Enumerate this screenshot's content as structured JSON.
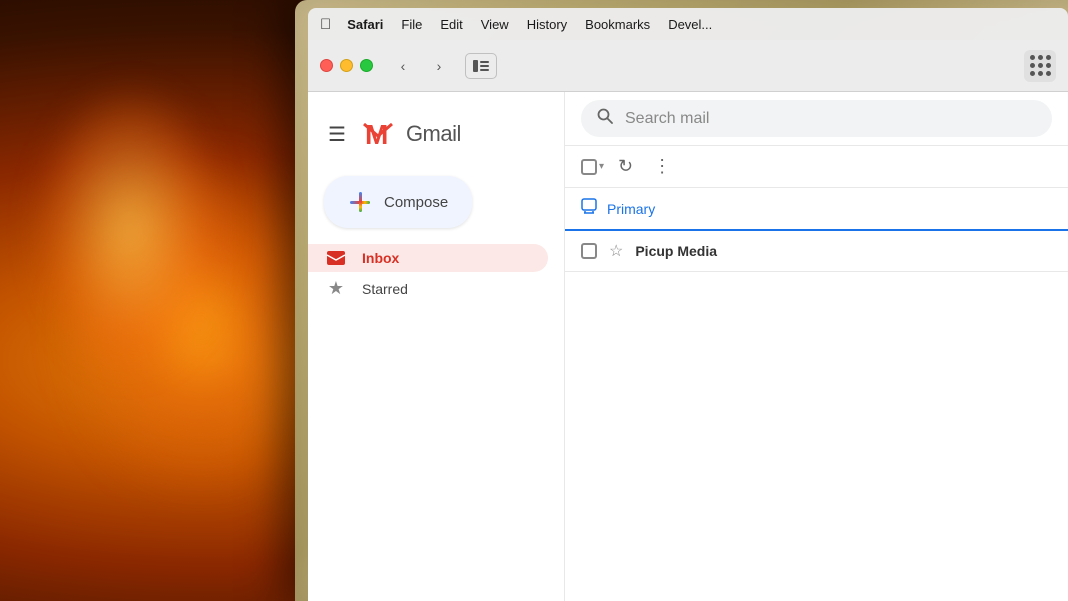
{
  "background": {
    "description": "warm fireplace bokeh background"
  },
  "menubar": {
    "apple_symbol": "&#63743;",
    "items": [
      {
        "label": "Safari",
        "bold": true
      },
      {
        "label": "File"
      },
      {
        "label": "Edit"
      },
      {
        "label": "View"
      },
      {
        "label": "History"
      },
      {
        "label": "Bookmarks"
      },
      {
        "label": "Devel..."
      }
    ]
  },
  "browser": {
    "traffic_lights": {
      "red": "#ff5f57",
      "yellow": "#febc2e",
      "green": "#28c840"
    },
    "back_button": "‹",
    "forward_button": "›"
  },
  "gmail": {
    "hamburger_label": "☰",
    "logo_m": "M",
    "wordmark": "Gmail",
    "compose_label": "Compose",
    "search_placeholder": "Search mail",
    "sidebar_items": [
      {
        "id": "inbox",
        "label": "Inbox",
        "active": true
      },
      {
        "id": "starred",
        "label": "Starred",
        "active": false
      }
    ],
    "email_toolbar": {
      "checkbox_label": "select all",
      "refresh_label": "↻",
      "more_label": "⋮"
    },
    "tabs": [
      {
        "id": "primary",
        "label": "Primary",
        "icon": "🖥"
      }
    ],
    "email_rows": [
      {
        "sender": "Picup Media",
        "preview": ""
      }
    ]
  }
}
